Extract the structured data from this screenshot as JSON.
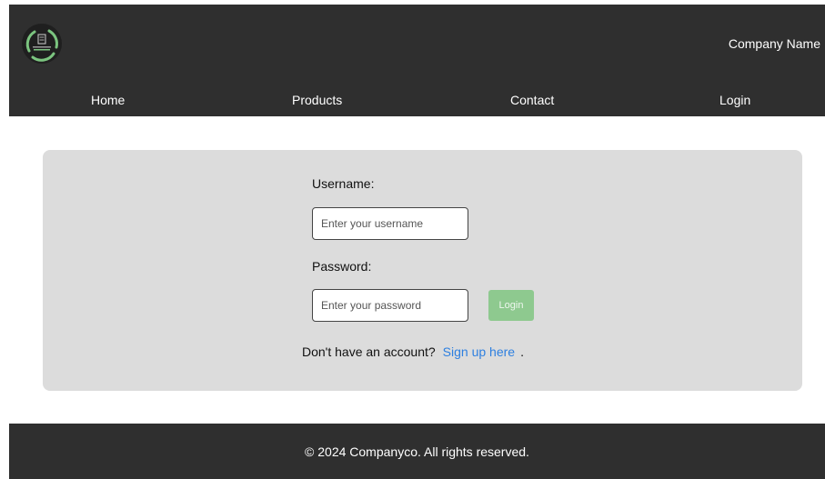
{
  "header": {
    "logo_icon": "leaf-ring-logo-icon",
    "company_name": "Company Name",
    "nav": {
      "home": "Home",
      "products": "Products",
      "contact": "Contact",
      "login": "Login"
    }
  },
  "login_form": {
    "username_label": "Username:",
    "username_placeholder": "Enter your username",
    "username_value": "",
    "password_label": "Password:",
    "password_placeholder": "Enter your password",
    "password_value": "",
    "login_button_label": "Login",
    "signup_prompt": "Don't have an account?",
    "signup_link": "Sign up here",
    "signup_suffix": "."
  },
  "footer": {
    "copyright": "© 2024 Companyco. All rights reserved."
  },
  "colors": {
    "header_bg": "#2f2f2f",
    "panel_bg": "#dcdcdc",
    "button_bg": "#8ec98f",
    "link": "#2d7fe0",
    "logo_accent": "#7bc47f"
  }
}
